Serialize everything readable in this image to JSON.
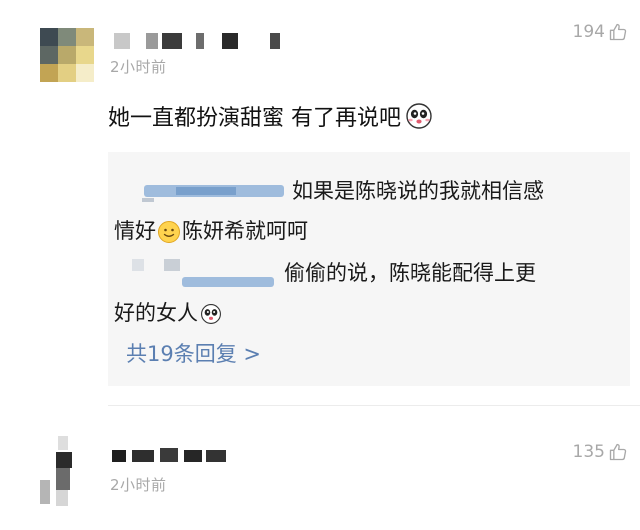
{
  "comments": [
    {
      "time": "2小时前",
      "likes": "194",
      "text": "她一直都扮演甜蜜 有了再说吧",
      "replies": [
        {
          "line1": "如果是陈晓说的我就相信感",
          "line2_a": "情好",
          "line2_b": "陈妍希就呵呵"
        },
        {
          "line1": "偷偷的说，陈晓能配得上更",
          "line2": "好的女人"
        }
      ],
      "more_replies": "共19条回复 >"
    },
    {
      "time": "2小时前",
      "likes": "135"
    }
  ],
  "icons": {
    "like": "thumbs-up-outline-icon",
    "emoji_panda": "panda-face-emoji-icon",
    "emoji_smile": "smiling-face-emoji-icon"
  },
  "colors": {
    "link": "#5b7fb1",
    "meta": "#a8a8a8",
    "reply_bg": "#f6f6f6"
  }
}
